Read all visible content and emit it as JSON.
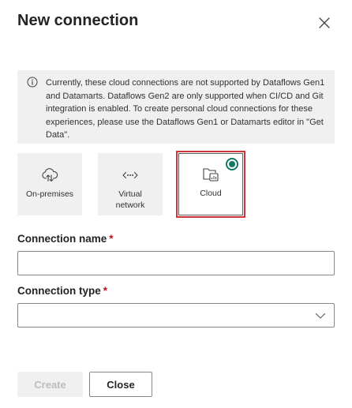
{
  "dialog": {
    "title": "New connection",
    "close_icon": "close-icon"
  },
  "info": {
    "icon": "info-icon",
    "text": "Currently, these cloud connections are not supported by Dataflows Gen1 and Datamarts. Dataflows Gen2 are only supported when CI/CD and Git integration is enabled. To create personal cloud connections for these experiences, please use the Dataflows Gen1 or Datamarts editor in \"Get Data\"."
  },
  "tiles": [
    {
      "label": "On-premises",
      "icon": "cloud-upload-icon",
      "selected": false
    },
    {
      "label": "Virtual\nnetwork",
      "icon": "virtual-network-icon",
      "selected": false
    },
    {
      "label": "Cloud",
      "icon": "cloud-folder-icon",
      "selected": true
    }
  ],
  "fields": {
    "connection_name": {
      "label": "Connection name",
      "required_mark": "*",
      "value": "",
      "placeholder": ""
    },
    "connection_type": {
      "label": "Connection type",
      "required_mark": "*",
      "value": "",
      "chevron_icon": "chevron-down-icon"
    }
  },
  "buttons": {
    "create": "Create",
    "close": "Close"
  },
  "colors": {
    "accent": "#117865",
    "selection_highlight": "#d13438",
    "required": "#c50f1f",
    "tile_background": "#f0f0f0"
  }
}
